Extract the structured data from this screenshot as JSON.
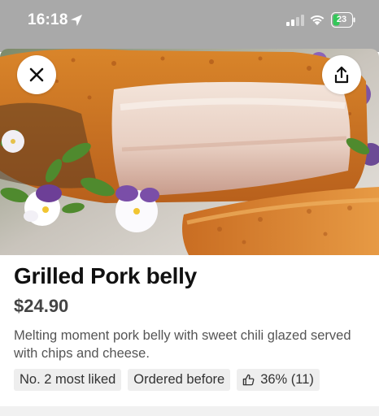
{
  "status_bar": {
    "time": "16:18",
    "battery": "23"
  },
  "icons": {
    "location": "location-arrow-icon",
    "signal": "cellular-signal-icon",
    "wifi": "wifi-icon",
    "battery": "battery-charging-icon",
    "close": "close-icon",
    "share": "share-icon",
    "like": "thumbs-up-icon"
  },
  "hero": {
    "image": "photo of grilled pork belly with crispy crackling, garnished with viola flowers and herbs"
  },
  "item": {
    "title": "Grilled Pork belly",
    "price": "$24.90",
    "description": "Melting moment pork belly with sweet chili glazed served with chips and cheese."
  },
  "tags": [
    {
      "label": "No. 2 most liked"
    },
    {
      "label": "Ordered before"
    },
    {
      "label": "36% (11)"
    }
  ],
  "colors": {
    "status_bar_bg": "#a9a9a9",
    "battery_fill": "#34c759",
    "tag_bg": "#eeeeee",
    "price": "#444444"
  }
}
